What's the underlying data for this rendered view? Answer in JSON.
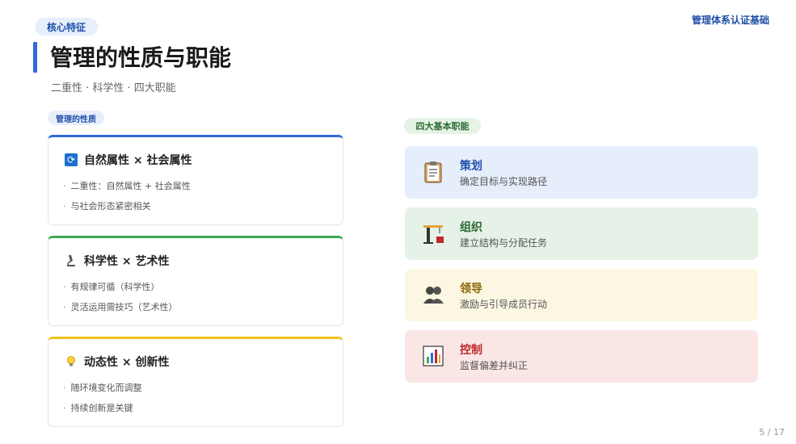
{
  "header": {
    "tag": "核心特征",
    "course": "管理体系认证基础",
    "title": "管理的性质与职能",
    "subtitle": "二重性 · 科学性 · 四大职能"
  },
  "nature": {
    "section_label": "管理的性质",
    "cards": [
      {
        "title": "自然属性 × 社会属性",
        "icon": "cycle-icon",
        "bullets": [
          "二重性：自然属性 + 社会属性",
          "与社会形态紧密相关"
        ]
      },
      {
        "title": "科学性 × 艺术性",
        "icon": "microscope-icon",
        "bullets": [
          "有规律可循（科学性）",
          "灵活运用需技巧（艺术性）"
        ]
      },
      {
        "title": "动态性 × 创新性",
        "icon": "lightbulb-icon",
        "bullets": [
          "随环境变化而调整",
          "持续创新是关键"
        ]
      }
    ]
  },
  "functions": {
    "section_label": "四大基本职能",
    "items": [
      {
        "name": "策划",
        "desc": "确定目标与实现路径",
        "icon": "clipboard-icon"
      },
      {
        "name": "组织",
        "desc": "建立结构与分配任务",
        "icon": "crane-icon"
      },
      {
        "name": "领导",
        "desc": "激励与引导成员行动",
        "icon": "people-icon"
      },
      {
        "name": "控制",
        "desc": "监督偏差并纠正",
        "icon": "bar-chart-icon"
      }
    ]
  },
  "footer": {
    "page": "5 / 17"
  },
  "colors": {
    "accent": "#2f6bd6",
    "green": "#3faa52",
    "yellow": "#f0c419",
    "red": "#c0282a"
  }
}
